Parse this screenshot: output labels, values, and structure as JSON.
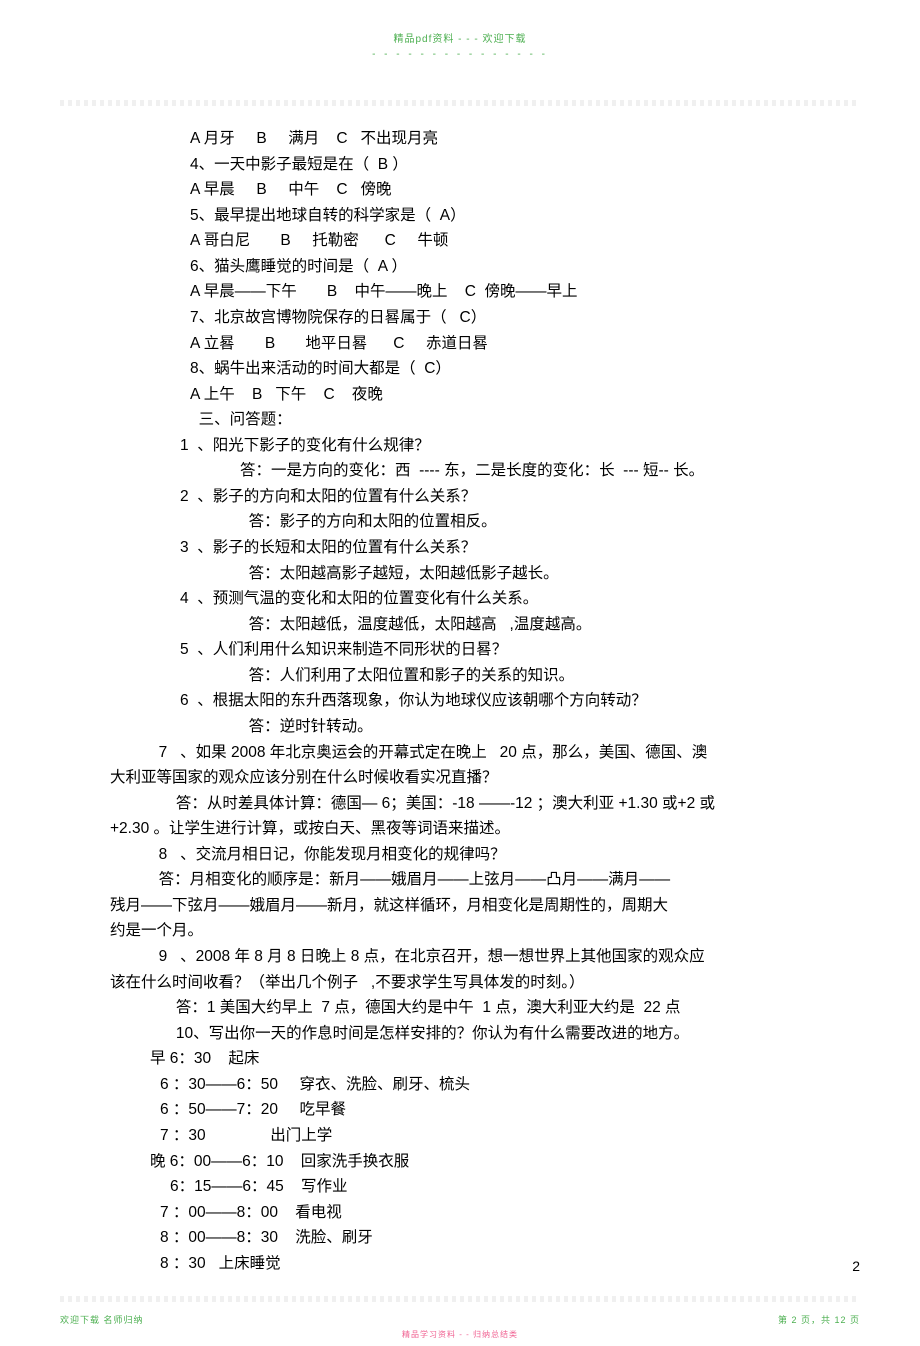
{
  "header": {
    "watermark": "精品pdf资料 - - - 欢迎下载",
    "dashes": "- - - - - - - - - - - - - - -"
  },
  "body": {
    "lines": [
      {
        "cls": "indent1",
        "text": "A 月牙     B     满月    C   不出现月亮"
      },
      {
        "cls": "indent1",
        "text": "4、一天中影子最短是在（  B ）"
      },
      {
        "cls": "indent1",
        "text": "A 早晨     B     中午    C   傍晚"
      },
      {
        "cls": "indent1",
        "text": "5、最早提出地球自转的科学家是（  A）"
      },
      {
        "cls": "indent1",
        "text": "A 哥白尼       B     托勒密      C     牛顿"
      },
      {
        "cls": "indent1",
        "text": "6、猫头鹰睡觉的时间是（  A ）"
      },
      {
        "cls": "indent1",
        "text": "A 早晨——下午       B    中午——晚上    C  傍晚——早上"
      },
      {
        "cls": "indent1",
        "text": "7、北京故宫博物院保存的日晷属于（   C）"
      },
      {
        "cls": "indent1",
        "text": "A 立晷       B       地平日晷      C     赤道日晷"
      },
      {
        "cls": "indent1",
        "text": "8、蜗牛出来活动的时间大都是（  C）"
      },
      {
        "cls": "indent1",
        "text": "A 上午    B   下午    C    夜晚"
      },
      {
        "cls": "indent1",
        "text": "  三、问答题："
      },
      {
        "cls": "indent-num",
        "text": "1  、阳光下影子的变化有什么规律？"
      },
      {
        "cls": "indent-ans",
        "text": "答：一是方向的变化：西  ---- 东，二是长度的变化：长  --- 短-- 长。"
      },
      {
        "cls": "indent-num",
        "text": "2  、影子的方向和太阳的位置有什么关系？"
      },
      {
        "cls": "indent-ans",
        "text": "  答：影子的方向和太阳的位置相反。"
      },
      {
        "cls": "indent-num",
        "text": "3  、影子的长短和太阳的位置有什么关系？"
      },
      {
        "cls": "indent-ans",
        "text": "  答：太阳越高影子越短，太阳越低影子越长。"
      },
      {
        "cls": "indent-num",
        "text": "4  、预测气温的变化和太阳的位置变化有什么关系。"
      },
      {
        "cls": "indent-ans",
        "text": "  答：太阳越低，温度越低，太阳越高   ,温度越高。"
      },
      {
        "cls": "indent-num",
        "text": "5  、人们利用什么知识来制造不同形状的日晷？"
      },
      {
        "cls": "indent-ans",
        "text": "  答：人们利用了太阳位置和影子的关系的知识。"
      },
      {
        "cls": "indent-num",
        "text": "6  、根据太阳的东升西落现象，你认为地球仪应该朝哪个方向转动？"
      },
      {
        "cls": "indent-ans",
        "text": "  答：逆时针转动。"
      },
      {
        "cls": "indent-para",
        "text": "  7   、如果 2008 年北京奥运会的开幕式定在晚上   20 点，那么，美国、德国、澳"
      },
      {
        "cls": "indent-flush",
        "text": "大利亚等国家的观众应该分别在什么时候收看实况直播？"
      },
      {
        "cls": "indent-para",
        "text": "      答：从时差具体计算：德国— 6；美国：-18 ——-12 ；澳大利亚 +1.30 或+2 或"
      },
      {
        "cls": "indent-flush",
        "text": "+2.30 。让学生进行计算，或按白天、黑夜等词语来描述。"
      },
      {
        "cls": "indent-para",
        "text": "  8   、交流月相日记，你能发现月相变化的规律吗？"
      },
      {
        "cls": "indent-para",
        "text": "  答：月相变化的顺序是：新月——娥眉月——上弦月——凸月——满月——"
      },
      {
        "cls": "indent-flush",
        "text": "残月——下弦月——娥眉月——新月，就这样循环，月相变化是周期性的，周期大"
      },
      {
        "cls": "indent-flush",
        "text": "约是一个月。"
      },
      {
        "cls": "indent-para",
        "text": "  9   、2008 年 8 月 8 日晚上 8 点，在北京召开，想一想世界上其他国家的观众应"
      },
      {
        "cls": "indent-flush",
        "text": "该在什么时间收看？（举出几个例子   ,不要求学生写具体发的时刻。）"
      },
      {
        "cls": "indent-para",
        "text": "      答：1 美国大约早上  7 点，德国大约是中午  1 点，澳大利亚大约是  22 点"
      },
      {
        "cls": "indent-para",
        "text": "      10、写出你一天的作息时间是怎样安排的？你认为有什么需要改进的地方。"
      },
      {
        "cls": "indent-sched0",
        "text": "早 6：30    起床"
      },
      {
        "cls": "indent-sched1",
        "text": "6 ：30——6：50     穿衣、洗脸、刷牙、梳头"
      },
      {
        "cls": "indent-sched1",
        "text": "6 ：50——7：20     吃早餐"
      },
      {
        "cls": "indent-sched1",
        "text": "7 ：30               出门上学"
      },
      {
        "cls": "indent-sched0",
        "text": "晚 6：00——6：10    回家洗手换衣服"
      },
      {
        "cls": "indent-sched2",
        "text": "6：15——6：45    写作业"
      },
      {
        "cls": "indent-sched1",
        "text": "7 ：00——8：00    看电视"
      },
      {
        "cls": "indent-sched1",
        "text": "8 ：00——8：30    洗脸、刷牙"
      },
      {
        "cls": "indent-sched1",
        "text": "8 ：30   上床睡觉"
      }
    ]
  },
  "footer": {
    "pageNumber": "2",
    "left": "欢迎下载  名师归纳",
    "right": "第 2 页，共 12 页",
    "center": "精品学习资料 - - 归纳总结类"
  }
}
